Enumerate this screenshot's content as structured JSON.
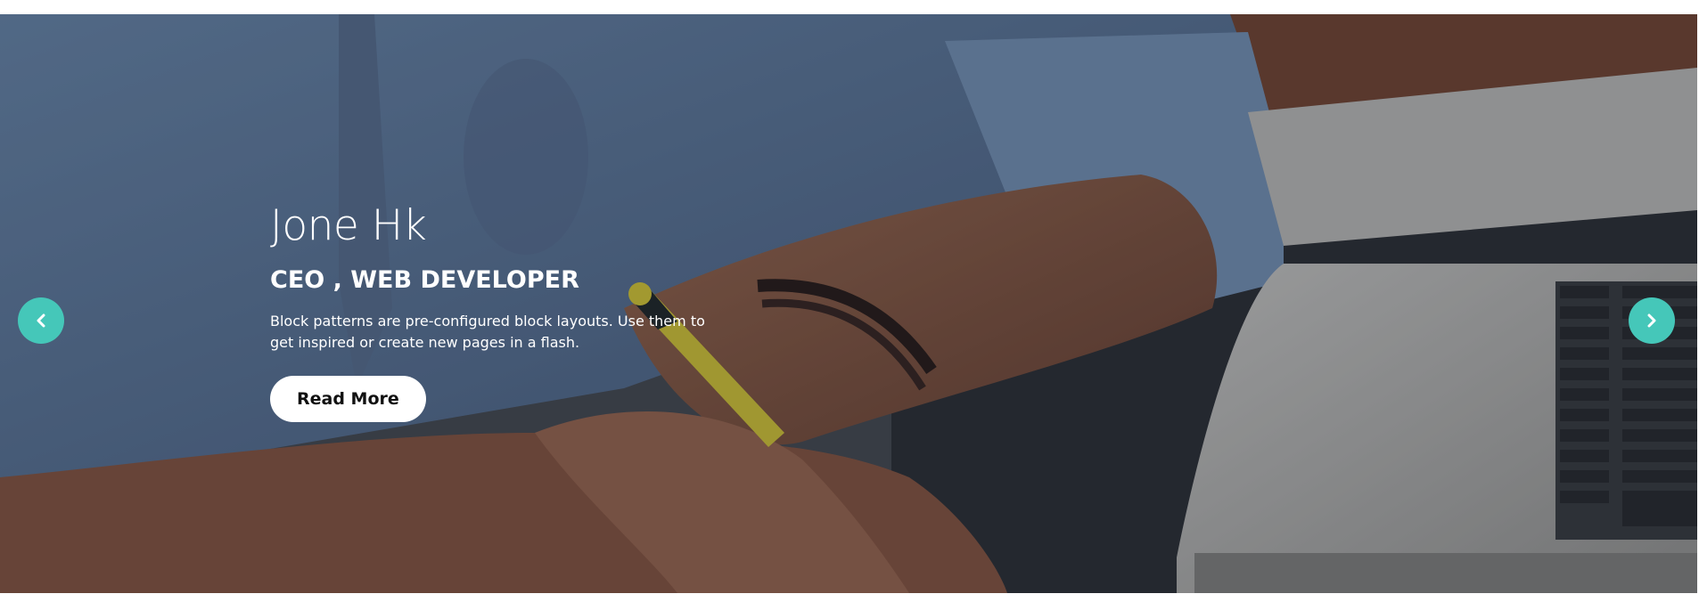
{
  "slide": {
    "name": "Jone Hk",
    "role": "CEO , WEB DEVELOPER",
    "description": "Block patterns are pre-configured block layouts. Use them to get inspired or create new pages in a flash.",
    "button_label": "Read More"
  },
  "controls": {
    "prev_icon": "chevron-left-icon",
    "next_icon": "chevron-right-icon"
  },
  "colors": {
    "accent": "#45c7b9",
    "text": "#ffffff",
    "button_bg": "#ffffff",
    "button_text": "#111111"
  }
}
